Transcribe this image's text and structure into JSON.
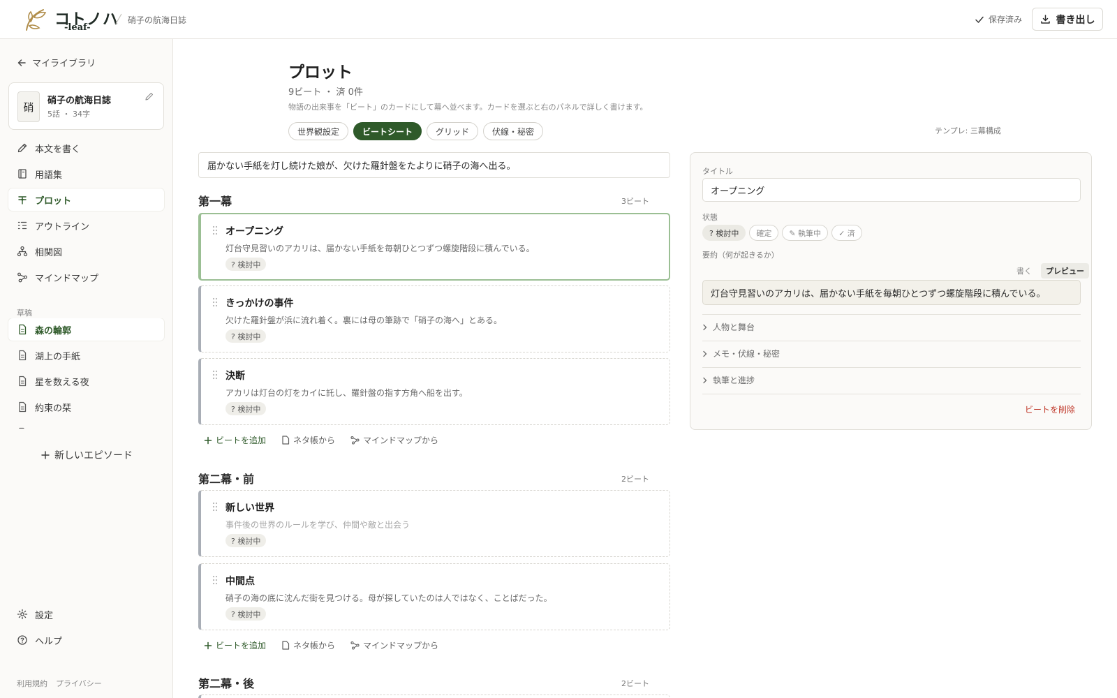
{
  "header": {
    "logo_name": "コトノハ",
    "logo_sub": "-leaf-",
    "breadcrumb": "硝子の航海日誌",
    "saved_label": "保存済み",
    "export_label": "書き出し"
  },
  "sidebar": {
    "back_label": "マイライブラリ",
    "project": {
      "avatar": "硝",
      "title": "硝子の航海日誌",
      "meta": "5話 ・ 34字"
    },
    "nav": [
      {
        "label": "本文を書く",
        "icon": "pencil-icon"
      },
      {
        "label": "用語集",
        "icon": "book-icon"
      },
      {
        "label": "プロット",
        "icon": "plot-icon",
        "active": true
      },
      {
        "label": "アウトライン",
        "icon": "outline-icon"
      },
      {
        "label": "相関図",
        "icon": "relation-icon"
      },
      {
        "label": "マインドマップ",
        "icon": "mindmap-icon"
      }
    ],
    "section_label": "草稿",
    "episodes": [
      {
        "label": "森の輪郭",
        "active": true
      },
      {
        "label": "湖上の手紙"
      },
      {
        "label": "星を数える夜"
      },
      {
        "label": "約束の栞"
      },
      {
        "label": "帰港"
      }
    ],
    "new_episode_label": "新しいエピソード",
    "bottom_nav": [
      {
        "label": "設定",
        "icon": "gear-icon"
      },
      {
        "label": "ヘルプ",
        "icon": "help-icon"
      }
    ],
    "footer_links": [
      "利用規約",
      "プライバシー"
    ]
  },
  "main": {
    "title": "プロット",
    "stats": "9ビート ・ 済 0件",
    "description": "物語の出来事を「ビート」のカードにして幕へ並べます。カードを選ぶと右のパネルで詳しく書けます。",
    "tabs": [
      {
        "label": "世界観設定"
      },
      {
        "label": "ビートシート",
        "active": true
      },
      {
        "label": "グリッド"
      },
      {
        "label": "伏線・秘密"
      }
    ],
    "template_label": "テンプレ: 三幕構成",
    "logline": "届かない手紙を灯し続けた娘が、欠けた羅針盤をたよりに硝子の海へ出る。",
    "acts": [
      {
        "title": "第一幕",
        "count": "3ビート",
        "beats": [
          {
            "title": "オープニング",
            "summary": "灯台守見習いのアカリは、届かない手紙を毎朝ひとつずつ螺旋階段に積んでいる。",
            "status": "? 検討中",
            "selected": true
          },
          {
            "title": "きっかけの事件",
            "summary": "欠けた羅針盤が浜に流れ着く。裏には母の筆跡で「硝子の海へ」とある。",
            "status": "? 検討中"
          },
          {
            "title": "決断",
            "summary": "アカリは灯台の灯をカイに託し、羅針盤の指す方角へ船を出す。",
            "status": "? 検討中"
          }
        ]
      },
      {
        "title": "第二幕・前",
        "count": "2ビート",
        "beats": [
          {
            "title": "新しい世界",
            "summary": "事件後の世界のルールを学び、仲間や敵と出会う",
            "status": "? 検討中",
            "placeholder": true
          },
          {
            "title": "中間点",
            "summary": "硝子の海の底に沈んだ街を見つける。母が探していたのは人ではなく、ことばだった。",
            "status": "? 検討中"
          }
        ]
      },
      {
        "title": "第二幕・後",
        "count": "2ビート",
        "beats": []
      }
    ],
    "act_actions": {
      "add_beat": "ビートを追加",
      "from_notes": "ネタ帳から",
      "from_mindmap": "マインドマップから"
    }
  },
  "panel": {
    "title_label": "タイトル",
    "title_value": "オープニング",
    "status_label": "状態",
    "status_options": [
      {
        "label": "? 検討中",
        "active": true
      },
      {
        "label": "確定"
      },
      {
        "label": "✎ 執筆中"
      },
      {
        "label": "✓ 済"
      }
    ],
    "summary_label": "要約（何が起きるか）",
    "mode_write": "書く",
    "mode_preview": "プレビュー",
    "summary_value": "灯台守見習いのアカリは、届かない手紙を毎朝ひとつずつ螺旋階段に積んでいる。",
    "sections": [
      "人物と舞台",
      "メモ・伏線・秘密",
      "執筆と進捗"
    ],
    "delete_label": "ビートを削除"
  },
  "colors": {
    "accent": "#2f5a2a",
    "selected_border": "#9bbf94",
    "danger": "#c0392b",
    "logo_gold": "#b08d4a"
  }
}
